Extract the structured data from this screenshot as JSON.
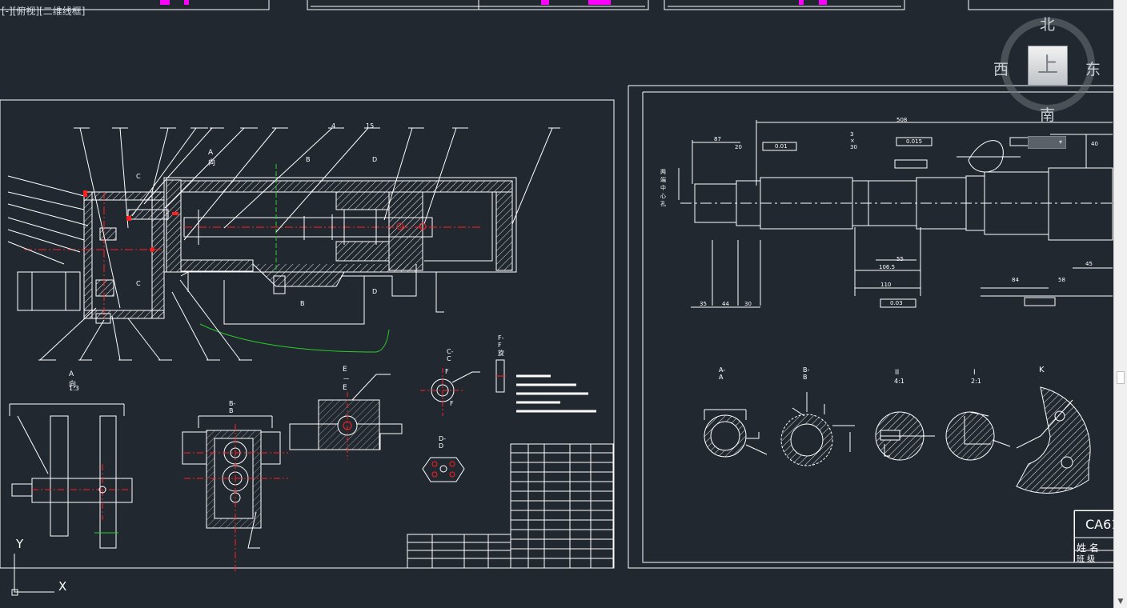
{
  "viewport": {
    "label": "[-][俯视][二维线框]"
  },
  "viewcube": {
    "north": "北",
    "south": "南",
    "east": "东",
    "west": "西",
    "top_face": "上"
  },
  "ucs": {
    "x_label": "X",
    "y_label": "Y"
  },
  "drawing_left": {
    "view_a_label": "A向",
    "view_a_detail_label": "A向",
    "view_a_detail_scale": "1:3",
    "section_bb": "B-B",
    "section_ee": "E－E",
    "section_cc": "C-C",
    "section_dd": "D-D",
    "view_ff": "F-F旋",
    "label_c": "C",
    "label_b": "B",
    "label_d": "D",
    "label_f": "F",
    "label_4": "4",
    "label_15": "15"
  },
  "drawing_right": {
    "dim_total": "508",
    "dim_87": "87",
    "dim_20": "20",
    "dim_3x30": "3 × 30",
    "dim_40": "40",
    "dim_35": "35",
    "dim_44": "44",
    "dim_30": "30",
    "dim_106_5": "106.5",
    "dim_55": "55",
    "dim_110": "110",
    "dim_84": "84",
    "dim_58": "58",
    "dim_45": "45",
    "section_aa": "A-A",
    "section_bb": "B-B",
    "detail_2": "II",
    "detail_2_scale": "4:1",
    "detail_1": "I",
    "detail_1_scale": "2:1",
    "view_k": "K",
    "tol_1": "0.01",
    "tol_2": "0.015",
    "tol_3": "0.03",
    "note_center": "两端中心孔"
  },
  "title_block": {
    "code": "CA61",
    "name_label": "姓 名",
    "class_label": "班 级"
  },
  "colors": {
    "background": "#212830",
    "line": "#ffffff",
    "centerline": "#ff2020",
    "highlight": "#ff00ff",
    "break_line": "#28d028",
    "dimension": "#ffffff"
  }
}
